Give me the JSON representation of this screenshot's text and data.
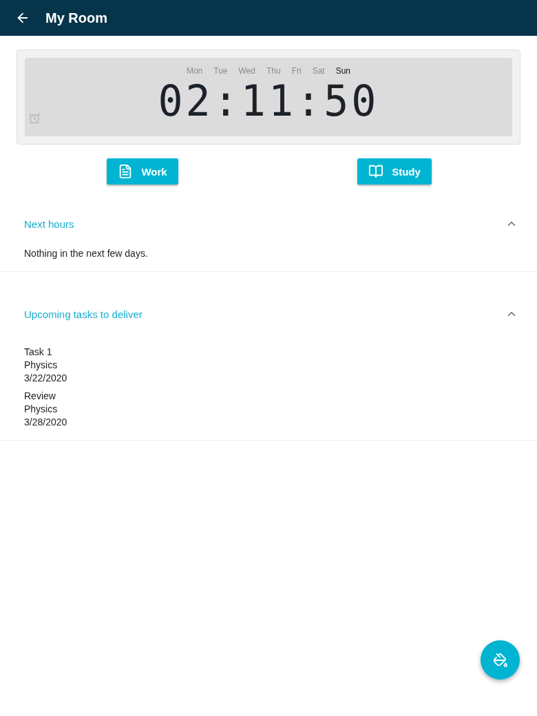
{
  "app_bar": {
    "title": "My Room"
  },
  "clock": {
    "days": [
      {
        "label": "Mon",
        "selected": false
      },
      {
        "label": "Tue",
        "selected": false
      },
      {
        "label": "Wed",
        "selected": false
      },
      {
        "label": "Thu",
        "selected": false
      },
      {
        "label": "Fri",
        "selected": false
      },
      {
        "label": "Sat",
        "selected": false
      },
      {
        "label": "Sun",
        "selected": true
      }
    ],
    "time": "02:11:50",
    "alarm_on": false
  },
  "buttons": [
    {
      "label": "Work",
      "kind": "document"
    },
    {
      "label": "Study",
      "kind": "book"
    }
  ],
  "sections": [
    {
      "title": "Next hours",
      "expanded": true,
      "empty_text": "Nothing in the next few days."
    },
    {
      "title": "Upcoming tasks to deliver",
      "expanded": true,
      "tasks": [
        {
          "name": "Task 1",
          "subject": "Physics",
          "date": "3/22/2020"
        },
        {
          "name": "Review",
          "subject": "Physics",
          "date": "3/28/2020"
        }
      ]
    }
  ]
}
